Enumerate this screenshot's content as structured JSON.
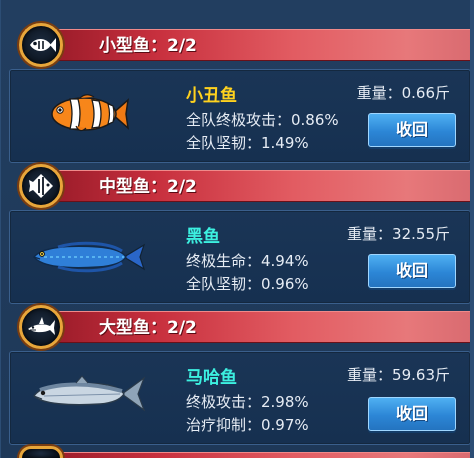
{
  "colors": {
    "name_small": "#ffd21e",
    "name_medium": "#3cf0e0",
    "name_large": "#3cf0e0",
    "button": "#2c86d6",
    "banner": "#c8303e"
  },
  "sections": [
    {
      "title": "小型鱼：2/2",
      "badge_icon": "small-fish-icon",
      "fish": {
        "name": "小丑鱼",
        "weight": "重量：0.66斤",
        "stat1": "全队终极攻击：0.86%",
        "stat2": "全队坚韧：1.49%",
        "button": "收回",
        "image": "clownfish-icon"
      }
    },
    {
      "title": "中型鱼：2/2",
      "badge_icon": "angelfish-icon",
      "fish": {
        "name": "黑鱼",
        "weight": "重量：32.55斤",
        "stat1": "终极生命：4.94%",
        "stat2": "全队坚韧：0.96%",
        "button": "收回",
        "image": "snakehead-fish-icon"
      }
    },
    {
      "title": "大型鱼：2/2",
      "badge_icon": "shark-icon",
      "fish": {
        "name": "马哈鱼",
        "weight": "重量：59.63斤",
        "stat1": "终极攻击：2.98%",
        "stat2": "治疗抑制：0.97%",
        "button": "收回",
        "image": "salmon-icon"
      }
    }
  ]
}
